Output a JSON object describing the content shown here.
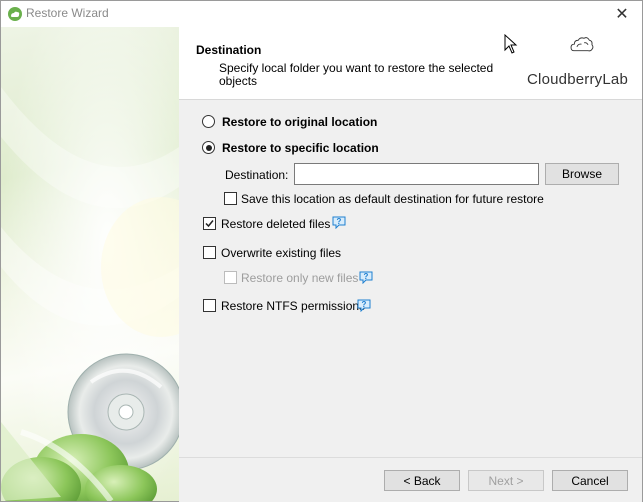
{
  "window": {
    "title": "Restore Wizard"
  },
  "header": {
    "title": "Destination",
    "description": "Specify local folder you want to restore the selected objects",
    "logo_text": "CloudberryLab"
  },
  "options": {
    "restore_original": {
      "label": "Restore to original location",
      "selected": false
    },
    "restore_specific": {
      "label": "Restore to specific location",
      "selected": true
    },
    "destination_label": "Destination:",
    "destination_value": "",
    "browse_label": "Browse",
    "save_default": {
      "label": "Save this location as default destination for future restore",
      "checked": false
    },
    "restore_deleted": {
      "label": "Restore deleted files",
      "checked": true
    },
    "overwrite": {
      "label": "Overwrite existing files",
      "checked": false
    },
    "restore_only_new": {
      "label": "Restore only new files",
      "checked": false,
      "enabled": false
    },
    "restore_ntfs": {
      "label": "Restore NTFS permissions",
      "checked": false
    }
  },
  "footer": {
    "back_label": "< Back",
    "next_label": "Next >",
    "cancel_label": "Cancel"
  },
  "colors": {
    "content_bg": "#f0f0f0",
    "help_icon": "#1e7fd0",
    "sidebar_green": "#9ccc65"
  }
}
